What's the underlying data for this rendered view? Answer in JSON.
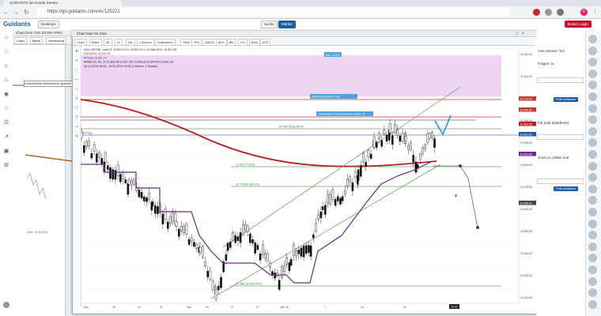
{
  "browser": {
    "tab_title": "GUIDANTS der Kunde Stream ...",
    "url": "https://go.guidants.com/#c/125221",
    "profile_initial": "K"
  },
  "app": {
    "logo": "Guidants",
    "header_buttons": [
      "Desktops"
    ],
    "search_label": "Suche",
    "markets_label": "Märkte",
    "broker_label": "Broker Login"
  },
  "background_chart": {
    "window_title": "Chart DAX TAG EXTRA PRO",
    "toolbar": [
      "Chart",
      "Markt",
      "Verzeichnis"
    ],
    "level_label": "Vorbörsliche Niemermine globale",
    "fib_label": "DAX, 1h-10 (R4)"
  },
  "chart_window": {
    "title": "Chart Dax-H1 Intra",
    "toolbar": [
      "Chart",
      "Markt",
      "3E",
      "Dr",
      "HA",
      "1 Woche",
      "Indikatoren",
      "SMA",
      "RSI",
      "MACD",
      "ADX",
      "BB",
      "CCI",
      "EMA",
      "ATR"
    ],
    "legend": [
      "DAX (XETRA, Last)  O: 10.811,21  H: 10.827,10  L: 10.584,03  C: 10.821,59",
      "EMA(200)  10.920,35",
      "PPO(4)  10.801,71",
      "RMGB 20, 52, 20  10.853,46  10.877,56  10.846,28  10.874,49  10.821,59",
      "18.12.2018 16:45  -  15.01.2019 10:00  (1 Woche, 1 Stunde)"
    ],
    "hlines": [
      {
        "label": "Bep. 11200",
        "value": 11200
      },
      {
        "label": "Widerstand (Siehe 10x1)",
        "value": 11085
      },
      {
        "label": "Vorbörsliche Pivot Widerstand (Siehe 10)",
        "value": 11038
      },
      {
        "label": "19.598,75 (61.80%)",
        "value": 10905
      },
      {
        "label": "KH Tag",
        "value": 10884
      },
      {
        "label": "12.601,71 (R4)",
        "value": 10785
      },
      {
        "label": "10.720,00 (38.2%)",
        "value": 10740
      },
      {
        "label": "10.486,15 (100.00%)",
        "value": 10567
      }
    ],
    "price_axis": [
      "11.300,00",
      "11.200,00",
      "11.100,00",
      "11.000,00",
      "10.900,00",
      "10.800,00",
      "10.700,00",
      "10.600,00",
      "10.500,00",
      "10.400,00",
      "10.300,00",
      "10.200,00"
    ],
    "price_tags": [
      "10.975,00",
      "10.940,00",
      "10.920,35",
      "10.821,59",
      "10.823,89",
      "10.686,20"
    ],
    "time_axis": [
      "Nov",
      "19",
      "14",
      "21",
      "Dez",
      "10",
      "17",
      "27",
      "Jan '19",
      "7",
      "14",
      "21",
      "10:00"
    ]
  },
  "chart_data": {
    "type": "candlestick",
    "title": "",
    "period_label": "1 Stunde",
    "ylim": [
      10100,
      11300
    ],
    "ohlc_sample_last": {
      "open": 10811.21,
      "high": 10827.1,
      "low": 10584.03,
      "close": 10821.59
    }
  },
  "right_panel": {
    "items": [
      {
        "text": "zum Service \"KO",
        "button": "Post verfassen"
      },
      {
        "text": "Fragen zu",
        "button": ""
      },
      {
        "text": "Für jede Zeitebene)",
        "button": ""
      },
      {
        "text": "chset zu 10850 und",
        "button": "Post verfassen"
      }
    ]
  }
}
